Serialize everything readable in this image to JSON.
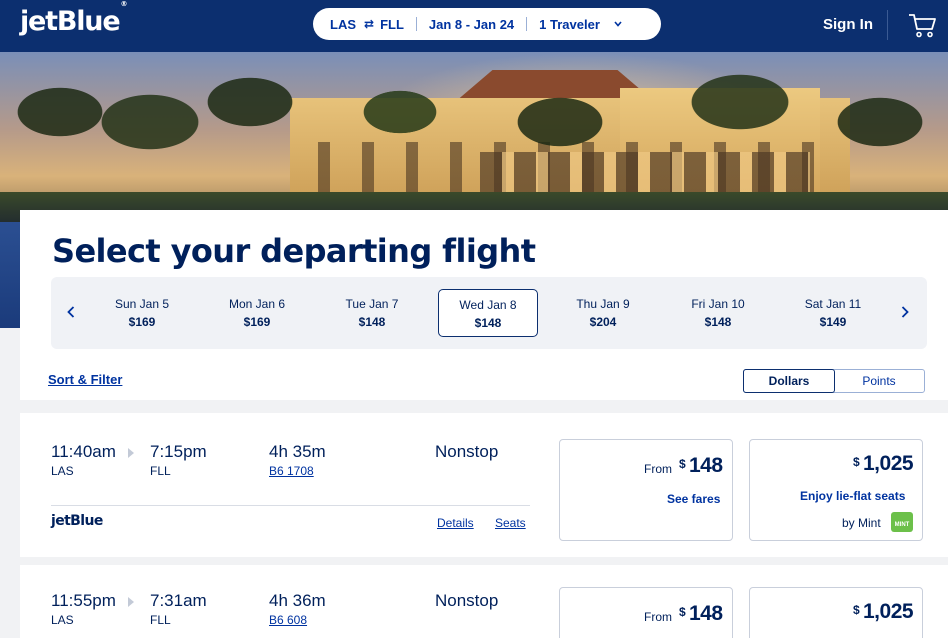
{
  "header": {
    "logo": "jetBlue",
    "logo_mark": "®",
    "search": {
      "origin": "LAS",
      "swap_icon": "⇄",
      "destination": "FLL",
      "dates": "Jan 8 - Jan 24",
      "travelers": "1 Traveler"
    },
    "signin_label": "Sign In"
  },
  "page_title": "Select your departing flight",
  "date_strip": [
    {
      "day": "Sun Jan 5",
      "price": "$169",
      "selected": false
    },
    {
      "day": "Mon Jan 6",
      "price": "$169",
      "selected": false
    },
    {
      "day": "Tue Jan 7",
      "price": "$148",
      "selected": false
    },
    {
      "day": "Wed Jan 8",
      "price": "$148",
      "selected": true
    },
    {
      "day": "Thu Jan 9",
      "price": "$204",
      "selected": false
    },
    {
      "day": "Fri Jan 10",
      "price": "$148",
      "selected": false
    },
    {
      "day": "Sat Jan 11",
      "price": "$149",
      "selected": false
    }
  ],
  "sort_filter_label": "Sort & Filter",
  "currency_toggle": {
    "dollars": "Dollars",
    "points": "Points",
    "active": "Dollars"
  },
  "flights": [
    {
      "depart_time": "11:40am",
      "depart_code": "LAS",
      "arrive_time": "7:15pm",
      "arrive_code": "FLL",
      "duration": "4h 35m",
      "flight_number": "B6 1708",
      "stops": "Nonstop",
      "airline": "jetBlue",
      "details_label": "Details",
      "seats_label": "Seats",
      "core_fare": {
        "from": "From",
        "currency": "$",
        "amount": "148",
        "link": "See fares"
      },
      "mint_fare": {
        "currency": "$",
        "amount": "1,025",
        "tagline": "Enjoy lie-flat seats",
        "by": "by Mint",
        "badge": "MINT"
      }
    },
    {
      "depart_time": "11:55pm",
      "depart_code": "LAS",
      "arrive_time": "7:31am",
      "arrive_code": "FLL",
      "duration": "4h 36m",
      "flight_number": "B6 608",
      "stops": "Nonstop",
      "core_fare": {
        "from": "From",
        "currency": "$",
        "amount": "148"
      },
      "mint_fare": {
        "currency": "$",
        "amount": "1,025"
      }
    }
  ]
}
